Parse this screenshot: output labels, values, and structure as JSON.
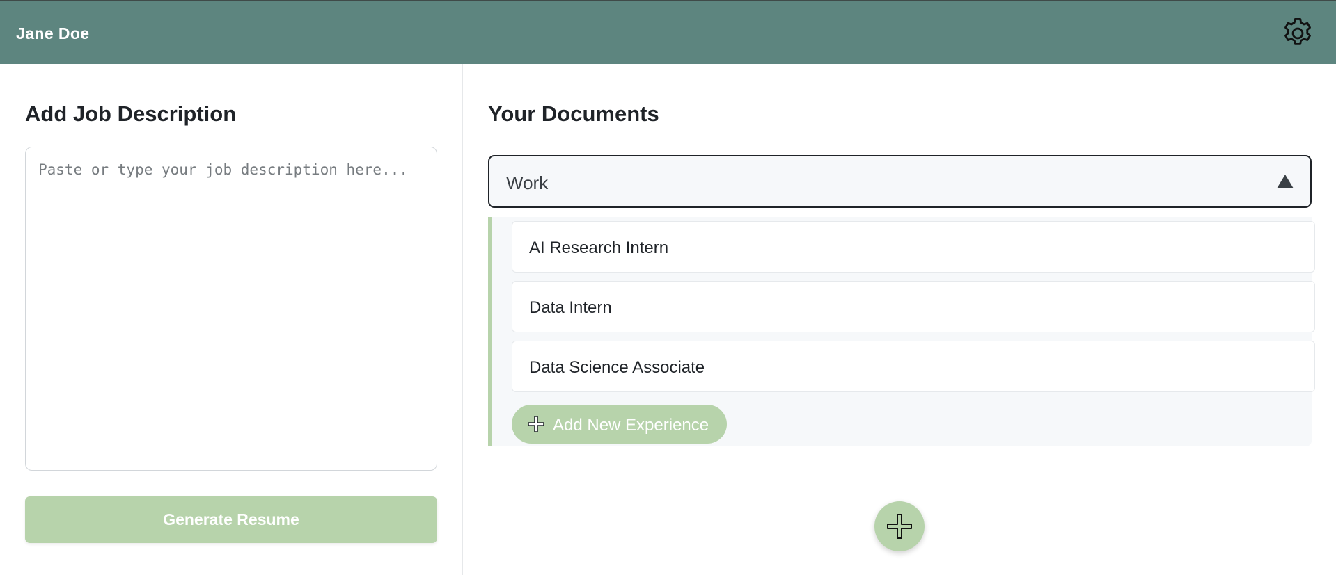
{
  "header": {
    "user_name": "Jane Doe",
    "settings_icon": "gear-icon",
    "background_color": "#5d857f"
  },
  "left_panel": {
    "title": "Add Job Description",
    "textarea": {
      "value": "",
      "placeholder": "Paste or type your job description here..."
    },
    "generate_button_label": "Generate Resume",
    "accent_color": "#b7d3ab"
  },
  "right_panel": {
    "title": "Your Documents",
    "folder": {
      "selected": "Work",
      "expanded": true,
      "items": [
        {
          "label": "AI Research Intern"
        },
        {
          "label": "Data Intern"
        },
        {
          "label": "Data Science Associate"
        }
      ],
      "add_button_label": "Add New Experience",
      "add_button_icon": "plus-icon"
    },
    "fab_icon": "plus-icon"
  }
}
